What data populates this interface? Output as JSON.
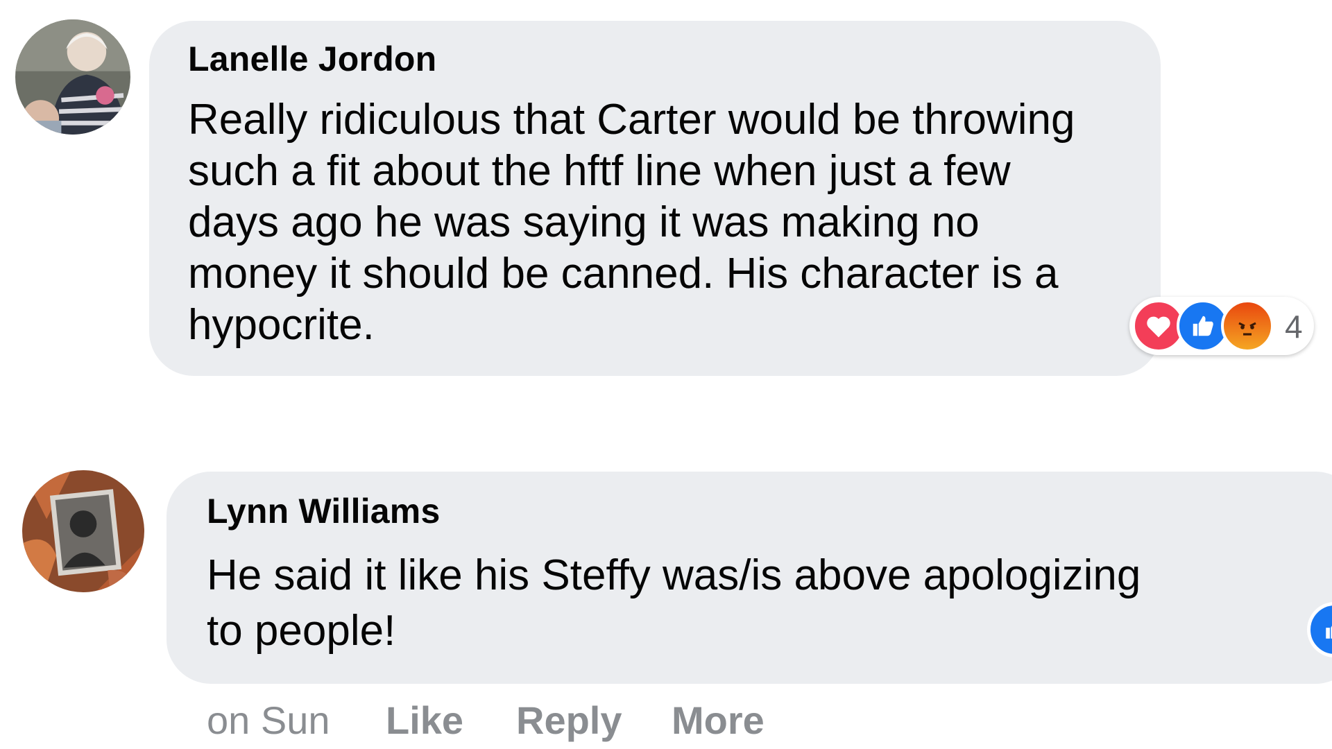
{
  "comments": [
    {
      "author": "Lanelle Jordon",
      "lines": [
        "Really ridiculous that Carter would be throwing",
        "such a fit about the hftf line when just a few",
        "days ago he was saying it was making no",
        "money it should be canned. His character is a",
        "hypocrite."
      ],
      "reactions": {
        "icons": [
          "heart-icon",
          "like-icon",
          "angry-icon"
        ],
        "count": "4"
      }
    },
    {
      "author": "Lynn Williams",
      "lines": [
        "He said it like his Steffy was/is above apologizing",
        "to people!"
      ],
      "actions": {
        "time": "on Sun",
        "like": "Like",
        "reply": "Reply",
        "more": "More"
      }
    }
  ],
  "colors": {
    "bubble": "#ebedf0",
    "heart": "#f33e58",
    "like": "#1877f2",
    "angry": "#e9710f",
    "meta_text": "#8a8d91"
  }
}
